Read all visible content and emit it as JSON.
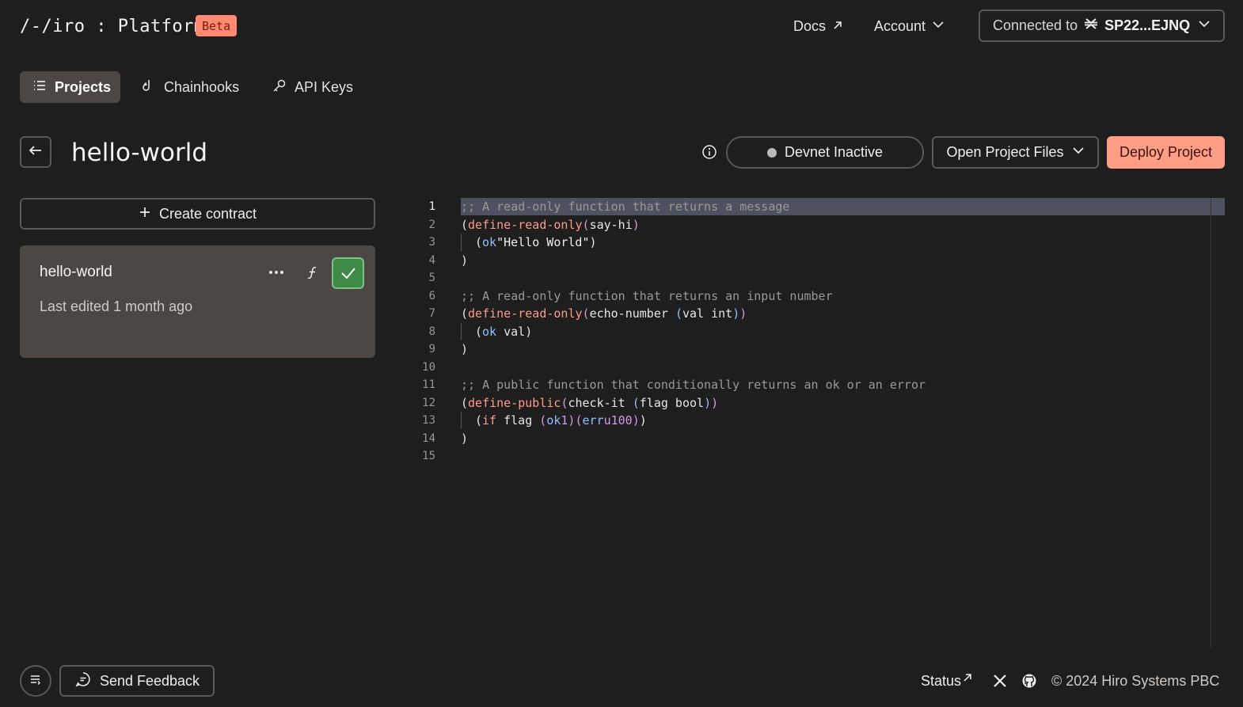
{
  "header": {
    "logo_text": "/-/iro : Platform",
    "badge": "Beta",
    "docs": "Docs",
    "account": "Account",
    "connected_prefix": "Connected to",
    "connected_address": "SP22...EJNQ"
  },
  "nav": {
    "projects": "Projects",
    "chainhooks": "Chainhooks",
    "api_keys": "API Keys"
  },
  "project": {
    "title": "hello-world",
    "devnet_status": "Devnet Inactive",
    "open_files": "Open Project Files",
    "deploy": "Deploy Project"
  },
  "sidebar": {
    "create_contract": "Create contract",
    "contract_card": {
      "name": "hello-world",
      "last_edited": "Last edited 1 month ago"
    }
  },
  "editor": {
    "active_line": 1,
    "lines": [
      ";; A read-only function that returns a message",
      "(define-read-only (say-hi)",
      "  (ok \"Hello World\")",
      ")",
      "",
      ";; A read-only function that returns an input number",
      "(define-read-only (echo-number (val int))",
      "  (ok val)",
      ")",
      "",
      ";; A public function that conditionally returns an ok or an error",
      "(define-public (check-it (flag bool))",
      "  (if flag (ok 1) (err u100))",
      ")",
      ""
    ]
  },
  "footer": {
    "send_feedback": "Send Feedback",
    "status": "Status",
    "copyright": "© 2024 Hiro Systems PBC"
  },
  "colors": {
    "background": "#1e1e1e",
    "accent": "#ff9e85",
    "badge": "#ff8a71",
    "check": "#3f8a46"
  }
}
